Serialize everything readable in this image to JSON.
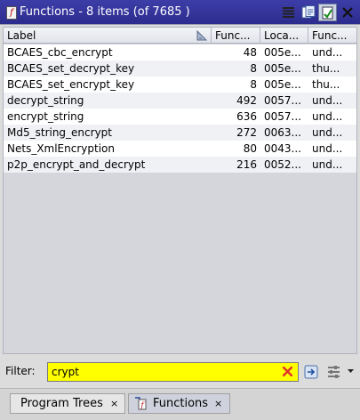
{
  "window": {
    "title": "Functions - 8 items (of 7685 )"
  },
  "table": {
    "columns": [
      {
        "label": "Label"
      },
      {
        "label": "Func..."
      },
      {
        "label": "Loca..."
      },
      {
        "label": "Func..."
      }
    ],
    "rows": [
      {
        "label": "BCAES_cbc_encrypt",
        "size": "48",
        "location": "005e...",
        "sig": "und..."
      },
      {
        "label": "BCAES_set_decrypt_key",
        "size": "8",
        "location": "005e...",
        "sig": "thu..."
      },
      {
        "label": "BCAES_set_encrypt_key",
        "size": "8",
        "location": "005e...",
        "sig": "thu..."
      },
      {
        "label": "decrypt_string",
        "size": "492",
        "location": "0057...",
        "sig": "und..."
      },
      {
        "label": "encrypt_string",
        "size": "636",
        "location": "0057...",
        "sig": "und..."
      },
      {
        "label": "Md5_string_encrypt",
        "size": "272",
        "location": "0063...",
        "sig": "und..."
      },
      {
        "label": "Nets_XmlEncryption",
        "size": "80",
        "location": "0043...",
        "sig": "und..."
      },
      {
        "label": "p2p_encrypt_and_decrypt",
        "size": "216",
        "location": "0052...",
        "sig": "und..."
      }
    ]
  },
  "filter": {
    "label": "Filter:",
    "value": "crypt"
  },
  "tabs": [
    {
      "label": "Program Trees",
      "close": "×"
    },
    {
      "label": "Functions",
      "close": "×"
    }
  ],
  "colors": {
    "title_bar": "#2c2c8e",
    "filter_highlight": "#ffff00"
  }
}
